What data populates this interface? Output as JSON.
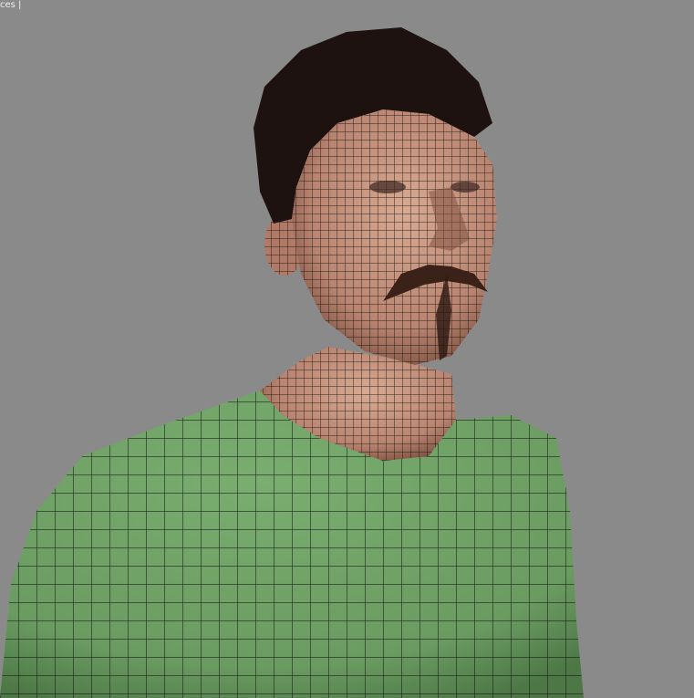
{
  "viewport": {
    "label": "ces |",
    "colors": {
      "background": "#8a8a8a",
      "skin": "#c99880",
      "skin_shadow": "#8a5a48",
      "hair": "#1e1210",
      "mustache": "#3a2218",
      "shirt": "#6f9f66",
      "shirt_shadow": "#4f7a48",
      "wire": "#101010"
    }
  }
}
